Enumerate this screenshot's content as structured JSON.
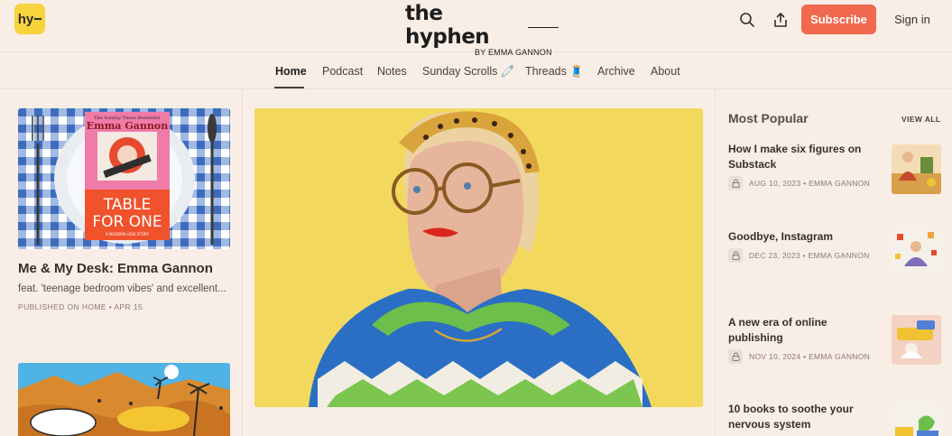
{
  "header": {
    "logo_text": "hy",
    "brand_title": "the hyphen",
    "brand_byline": "BY EMMA GANNON",
    "subscribe_label": "Subscribe",
    "signin_label": "Sign in",
    "icons": [
      "search-icon",
      "share-icon"
    ]
  },
  "nav": {
    "items": [
      {
        "label": "Home",
        "active": true
      },
      {
        "label": "Podcast"
      },
      {
        "label": "Notes"
      },
      {
        "label": "Sunday Scrolls 🧷"
      },
      {
        "label": "Threads 🧵"
      },
      {
        "label": "Archive"
      },
      {
        "label": "About"
      }
    ]
  },
  "left_post": {
    "book_tag": "The Sunday Times Bestseller",
    "book_author": "Emma Gannon",
    "book_title_1": "TABLE",
    "book_title_2": "FOR ONE",
    "book_tagline": "A MODERN LOVE STORY",
    "title": "Me & My Desk: Emma Gannon",
    "subtitle": "feat. 'teenage bedroom vibes' and excellent...",
    "meta": "PUBLISHED ON HOME  • APR 15"
  },
  "popular": {
    "heading": "Most Popular",
    "view_all": "VIEW ALL",
    "items": [
      {
        "title": "How I make six figures on Substack",
        "meta": "AUG 10, 2023 • EMMA GANNON"
      },
      {
        "title": "Goodbye, Instagram",
        "meta": "DEC 23, 2023 • EMMA GANNON"
      },
      {
        "title": "A new era of online publishing",
        "meta": "NOV 10, 2024 • EMMA GANNON"
      },
      {
        "title": "10 books to soothe your nervous system",
        "meta": ""
      }
    ]
  },
  "colors": {
    "background": "#f9eee6",
    "accent": "#f0694f",
    "logo": "#f7d33c",
    "hero_bg": "#f2d95e"
  }
}
